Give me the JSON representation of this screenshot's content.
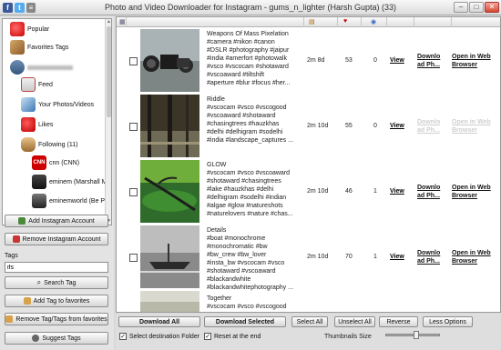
{
  "window": {
    "title": "Photo and Video Downloader for Instagram - gums_n_lighter (Harsh Gupta) (33)",
    "minimize": "–",
    "maximize": "□",
    "close": "✕"
  },
  "tree": {
    "items": [
      {
        "label": "Popular",
        "icon": "heart-icon"
      },
      {
        "label": "Favorites Tags",
        "icon": "tags-icon"
      },
      {
        "label": "",
        "icon": "user-account-icon"
      },
      {
        "label": "Feed",
        "icon": "home-icon"
      },
      {
        "label": "Your Photos/Videos",
        "icon": "photos-icon"
      },
      {
        "label": "Likes",
        "icon": "heart-icon"
      },
      {
        "label": "Following (11)",
        "icon": "users-icon"
      },
      {
        "label": "cnn (CNN)",
        "icon": "avatar-cnn"
      },
      {
        "label": "eminem (Marshall M",
        "icon": "avatar-eminem"
      },
      {
        "label": "eminemworld (Be P",
        "icon": "avatar-eminemworld"
      }
    ]
  },
  "left": {
    "add_account": "Add Instagram Account",
    "remove_account": "Remove Instagram Account",
    "tags_label": "Tags",
    "tags_value": "ifs",
    "search_tag": "Search Tag",
    "add_tag_fav": "Add Tag to favorites",
    "remove_tag_fav": "Remove Tag/Tags from favorites",
    "suggest_tags": "Suggest Tags"
  },
  "grid": {
    "header_icons": [
      "image-column-icon",
      "calendar-icon",
      "heart-icon",
      "comments-icon"
    ],
    "rows": [
      {
        "desc": "Weapons Of Mass Pixelation\n#camera #nikon #canon\n#DSLR #photography #jaipur\n#india #amerfort #photowalk\n#vsco #vscocam #shotaward\n#vscoaward #tiltshift\n#aperture #blur #focus #her...",
        "age": "2m 8d",
        "likes": "53",
        "comments": "0",
        "view": "View",
        "download": "Downlo\nad Ph...",
        "open": "Open in Web\nBrowser",
        "dimmed": false
      },
      {
        "desc": "Riddle\n#vscocam #vsco #vscogood\n#vscoaward #shotaward\n#chasingtrees #hauzkhas\n#delhi #delhigram #sodelhi\n#india #landscape_captures ...",
        "age": "2m 10d",
        "likes": "55",
        "comments": "0",
        "view": "View",
        "download": "Downlo\nad Ph...",
        "open": "Open in Web\nBrowser",
        "dimmed": true
      },
      {
        "desc": "GLOW\n#vscocam #vsco #vscoaward\n#shotaward #chasingtrees\n#lake #hauzkhas #delhi\n#delhigram #sodelhi #indian\n#algae #glow #natureshots\n#naturelovers #nature #chas...",
        "age": "2m 10d",
        "likes": "46",
        "comments": "1",
        "view": "View",
        "download": "Downlo\nad Ph...",
        "open": "Open in Web\nBrowser",
        "dimmed": false
      },
      {
        "desc": "Details\n#boat #monochrome\n#monochromatic #bw\n#bw_crew #bw_lover\n#insta_bw #vscocam #vsco\n#shotaward #vscoaward\n#blackandwhite\n#blackandwhitephotography ...",
        "age": "2m 10d",
        "likes": "70",
        "comments": "1",
        "view": "View",
        "download": "Downlo\nad Ph...",
        "open": "Open in Web\nBrowser",
        "dimmed": false
      },
      {
        "desc": "Together\n#vscocam #vsco #vscogood",
        "age": "",
        "likes": "",
        "comments": "",
        "view": "",
        "download": "",
        "open": "",
        "dimmed": false
      }
    ]
  },
  "toolbar": {
    "download_all": "Download All",
    "download_selected": "Download Selected",
    "select_all": "Select All",
    "unselect_all": "Unselect All",
    "reverse": "Reverse",
    "less_options": "Less Options",
    "select_dest": "Select destination Folder",
    "select_dest_checked": true,
    "reset_end": "Reset at the end",
    "reset_end_checked": true,
    "thumb_size_label": "Thumbnails Size",
    "thumb_size_level": 0.55
  }
}
